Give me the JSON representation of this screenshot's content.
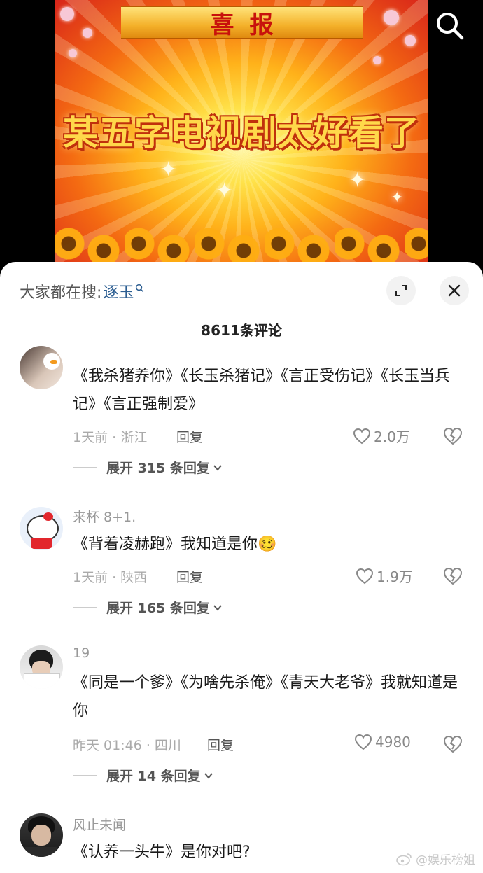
{
  "video": {
    "banner_text": "喜报",
    "headline": "某五字电视剧太好看了",
    "search_button_icon": "search-icon"
  },
  "sheet": {
    "search_prefix": "大家都在搜:",
    "search_keyword": "逐玉",
    "expand_icon": "expand-icon",
    "close_icon": "close-icon",
    "comment_count": "8611条评论"
  },
  "comments": [
    {
      "username": "",
      "text": "《我杀猪养你》《长玉杀猪记》《言正受伤记》《长玉当兵记》《言正强制爱》",
      "time_location": "1天前 · 浙江",
      "reply_label": "回复",
      "likes": "2.0万",
      "expand_label": "展开 315 条回复"
    },
    {
      "username": "来杯 8+1.",
      "text": "《背着凌赫跑》我知道是你🥴",
      "time_location": "1天前 · 陕西",
      "reply_label": "回复",
      "likes": "1.9万",
      "expand_label": "展开 165 条回复"
    },
    {
      "username": "19",
      "text": "《同是一个爹》《为啥先杀俺》《青天大老爷》我就知道是你",
      "time_location": "昨天 01:46 · 四川",
      "reply_label": "回复",
      "likes": "4980",
      "expand_label": "展开 14 条回复"
    },
    {
      "username": "风止未闻",
      "text": "《认养一头牛》是你对吧?",
      "time_location": "",
      "reply_label": "",
      "likes": "",
      "expand_label": ""
    }
  ],
  "watermark": "@娱乐榜姐",
  "colors": {
    "keyword": "#2b5d91",
    "banner_text": "#c8120c",
    "headline": "#ffd84a"
  }
}
